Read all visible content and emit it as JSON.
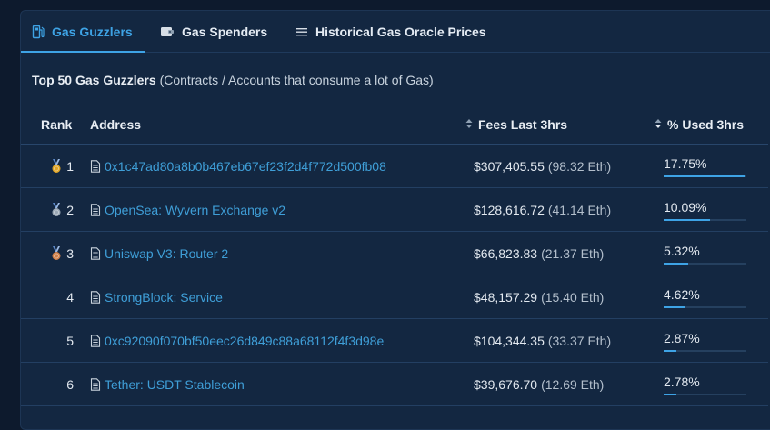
{
  "tabs": [
    {
      "label": "Gas Guzzlers",
      "icon": "gas-pump-icon"
    },
    {
      "label": "Gas Spenders",
      "icon": "wallet-icon"
    },
    {
      "label": "Historical Gas Oracle Prices",
      "icon": "list-icon"
    }
  ],
  "heading": {
    "title": "Top 50 Gas Guzzlers",
    "subtitle": "(Contracts / Accounts that consume a lot of Gas)"
  },
  "table": {
    "headers": {
      "rank": "Rank",
      "address": "Address",
      "fees": "Fees Last 3hrs",
      "pct": "% Used 3hrs"
    },
    "rows": [
      {
        "rank": "1",
        "medal": "gold-medal-icon",
        "address": "0x1c47ad80a8b0b467eb67ef23f2d4f772d500fb08",
        "fee": "$307,405.55",
        "eth": "(98.32 Eth)",
        "pct": "17.75%",
        "pct_value": 17.75
      },
      {
        "rank": "2",
        "medal": "silver-medal-icon",
        "address": "OpenSea: Wyvern Exchange v2",
        "fee": "$128,616.72",
        "eth": "(41.14 Eth)",
        "pct": "10.09%",
        "pct_value": 10.09
      },
      {
        "rank": "3",
        "medal": "bronze-medal-icon",
        "address": "Uniswap V3: Router 2",
        "fee": "$66,823.83",
        "eth": "(21.37 Eth)",
        "pct": "5.32%",
        "pct_value": 5.32
      },
      {
        "rank": "4",
        "medal": "",
        "address": "StrongBlock: Service",
        "fee": "$48,157.29",
        "eth": "(15.40 Eth)",
        "pct": "4.62%",
        "pct_value": 4.62
      },
      {
        "rank": "5",
        "medal": "",
        "address": "0xc92090f070bf50eec26d849c88a68112f4f3d98e",
        "fee": "$104,344.35",
        "eth": "(33.37 Eth)",
        "pct": "2.87%",
        "pct_value": 2.87
      },
      {
        "rank": "6",
        "medal": "",
        "address": "Tether: USDT Stablecoin",
        "fee": "$39,676.70",
        "eth": "(12.69 Eth)",
        "pct": "2.78%",
        "pct_value": 2.78
      }
    ]
  },
  "colors": {
    "accent": "#3ea3e5",
    "gold": "#e0a526",
    "silver": "#9aa7b4",
    "bronze": "#d0804a"
  }
}
